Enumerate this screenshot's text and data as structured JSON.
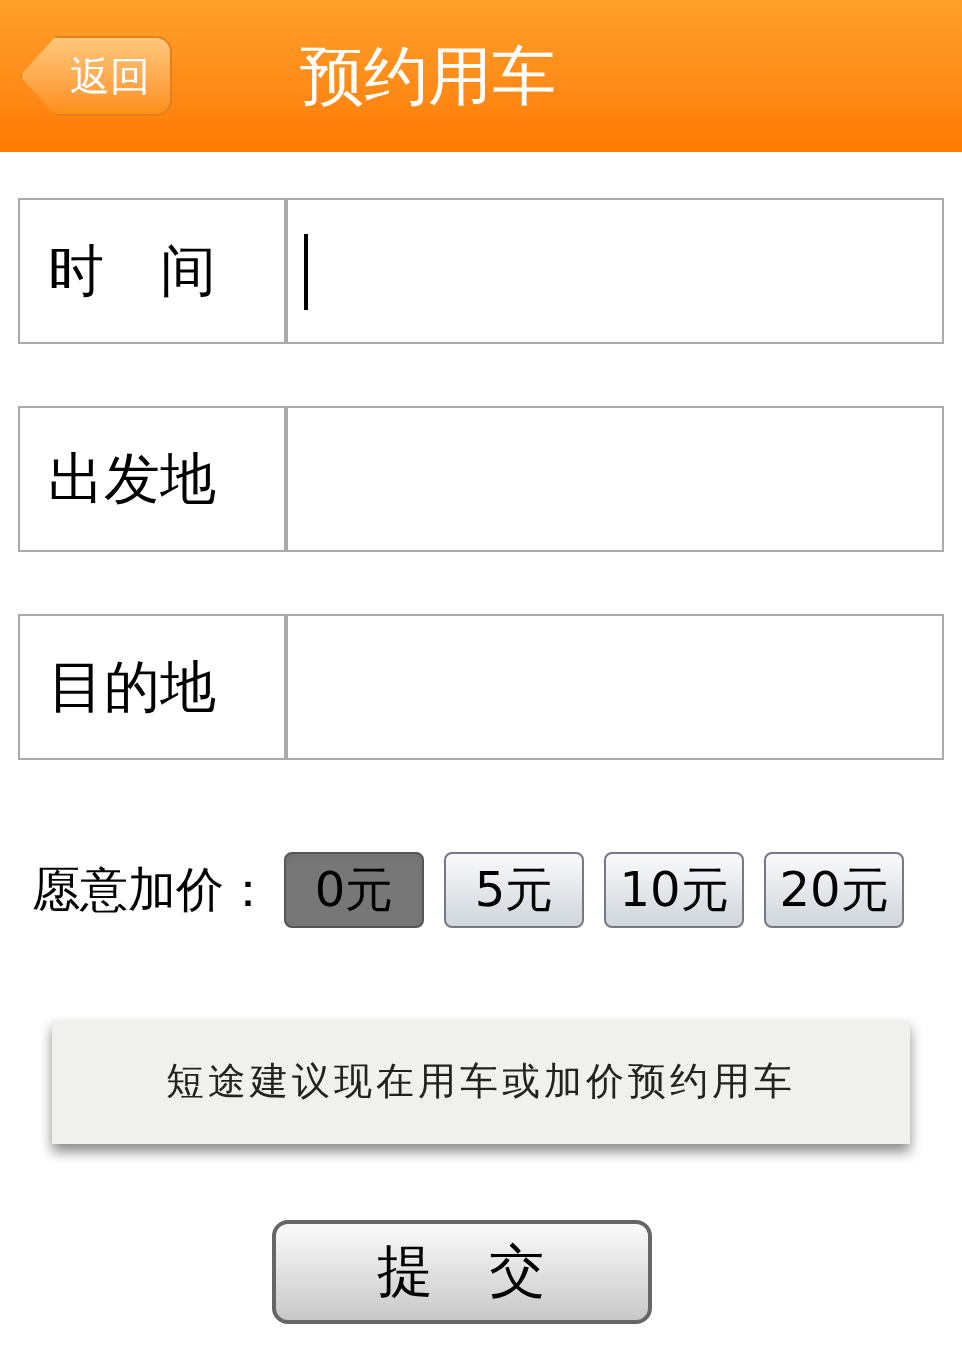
{
  "header": {
    "back": "返回",
    "title": "预约用车"
  },
  "fields": [
    {
      "label": "时　间",
      "focused": true
    },
    {
      "label": "出发地",
      "focused": false
    },
    {
      "label": "目的地",
      "focused": false
    }
  ],
  "surcharge": {
    "label": "愿意加价：",
    "options": [
      {
        "label": "0元",
        "selected": true
      },
      {
        "label": "5元",
        "selected": false
      },
      {
        "label": "10元",
        "selected": false
      },
      {
        "label": "20元",
        "selected": false
      }
    ]
  },
  "notice": "短途建议现在用车或加价预约用车",
  "submit": "提　交"
}
